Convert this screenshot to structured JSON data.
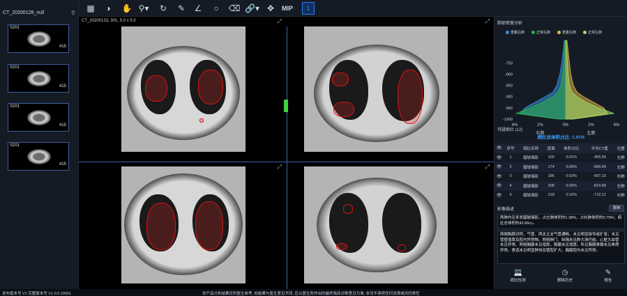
{
  "series_panel": {
    "title": "CT_20200128_null",
    "thumbnails": [
      {
        "label": "S201",
        "count": "415"
      },
      {
        "label": "S201",
        "count": "415"
      },
      {
        "label": "S201",
        "count": "415"
      },
      {
        "label": "S201",
        "count": "415"
      }
    ]
  },
  "toolbar": {
    "icons": [
      "layout-grid-icon",
      "window-level-icon",
      "pan-icon",
      "zoom-icon",
      "rotate-icon",
      "ruler-icon",
      "angle-icon",
      "ellipse-roi-icon",
      "eraser-icon",
      "link-icon",
      "crosshair-icon"
    ],
    "mip_label": "MIP",
    "active_label": "1"
  },
  "viewport": {
    "info": "CT_20200123, 301, 5.0 x 5.0"
  },
  "density": {
    "title": "肺部密度分析",
    "legend": [
      {
        "label": "重叠右肺",
        "color": "#3c8fe0"
      },
      {
        "label": "正常右肺",
        "color": "#2bb34a"
      },
      {
        "label": "重叠左肺",
        "color": "#e0b64b"
      },
      {
        "label": "正常左肺",
        "color": "#9fe06a"
      }
    ]
  },
  "chart_data": {
    "type": "area",
    "title": "",
    "ylabel": "",
    "y_ticks": [
      "-750",
      "-800",
      "-850",
      "-900",
      "-950",
      "-1000"
    ],
    "x_ticks": [
      "4%",
      "2%",
      "0%",
      "2%",
      "4%"
    ],
    "side_labels": {
      "left": "右肺",
      "right": "左肺"
    },
    "ylim": [
      -1000,
      -650
    ],
    "series": [
      {
        "name": "重叠右肺",
        "side": "left",
        "x": [
          -650,
          -700,
          -750,
          -800,
          -850,
          -880,
          -900,
          -925,
          -950,
          -975,
          -1000
        ],
        "values": [
          0.1,
          0.2,
          0.3,
          0.45,
          0.7,
          1.0,
          1.6,
          2.4,
          3.2,
          3.6,
          0.5
        ]
      },
      {
        "name": "正常右肺",
        "side": "left",
        "x": [
          -650,
          -700,
          -750,
          -800,
          -850,
          -880,
          -900,
          -925,
          -950,
          -975,
          -1000
        ],
        "values": [
          0.05,
          0.1,
          0.15,
          0.25,
          0.35,
          0.6,
          1.0,
          1.8,
          2.8,
          3.9,
          0.6
        ]
      },
      {
        "name": "重叠左肺",
        "side": "right",
        "x": [
          -650,
          -700,
          -750,
          -800,
          -850,
          -880,
          -900,
          -925,
          -950,
          -975,
          -1000
        ],
        "values": [
          0.1,
          0.2,
          0.3,
          0.4,
          0.6,
          0.9,
          1.4,
          2.2,
          3.0,
          3.3,
          0.5
        ]
      },
      {
        "name": "正常左肺",
        "side": "right",
        "x": [
          -650,
          -700,
          -750,
          -800,
          -850,
          -880,
          -900,
          -925,
          -950,
          -975,
          -1000
        ],
        "values": [
          0.05,
          0.1,
          0.15,
          0.2,
          0.3,
          0.5,
          0.9,
          1.6,
          2.6,
          3.8,
          0.6
        ]
      }
    ]
  },
  "lesions": {
    "title": "可疑病灶 (12)",
    "total_ratio": "病灶总体积占比: 1.01%",
    "headers": [
      "序号",
      "病灶名称",
      "层面",
      "体积占比",
      "平均CT值",
      "位置"
    ],
    "rows": [
      [
        "1",
        "磨玻璃影",
        "100",
        "0.01%",
        "-405.56",
        "左肺"
      ],
      [
        "2",
        "磨玻璃影",
        "174",
        "0.06%",
        "-689.56",
        "左肺"
      ],
      [
        "3",
        "磨玻璃影",
        "186",
        "0.02%",
        "-697.15",
        "右肺"
      ],
      [
        "4",
        "磨玻璃影",
        "208",
        "0.00%",
        "-819.68",
        "左肺"
      ],
      [
        "5",
        "磨玻璃影",
        "218",
        "0.16%",
        "-712.11",
        "右肺"
      ]
    ]
  },
  "report": {
    "title": "影像描述",
    "copy_label": "复制",
    "finding": "两肺内见多发磨玻璃影，占左肺体积的1.38%，占右肺体积的0.79%；病灶总体积约42.66cc。",
    "description": "两侧胸廓对称，气管、两支主支气管通畅，未见明显狭窄或扩张；未见管壁增厚及腔内异常物。两侧肺门、纵隔未见肿大淋巴结。心脏大血管未见异常。两侧胸膜未见增厚，胸膜未见增厚。所见胸膜骨骼未见骨质异常。食道未见明显肿块及管腔扩大。胸膜腔内未见异常。"
  },
  "actions": [
    {
      "label": "病灶检测",
      "icon": "monitor-icon"
    },
    {
      "label": "删除历史",
      "icon": "clock-icon"
    },
    {
      "label": "报告",
      "icon": "edit-icon"
    }
  ],
  "status": {
    "version": "发布版本号 V1 完整版本号 V1.0.0.19001",
    "disclaimer": "本产品分析结果仅供医生参考, 如结果与医生意见不同, 应以医生所作出的最终临床诊断意见为准, 本司不承担任何法律或共同责任"
  }
}
